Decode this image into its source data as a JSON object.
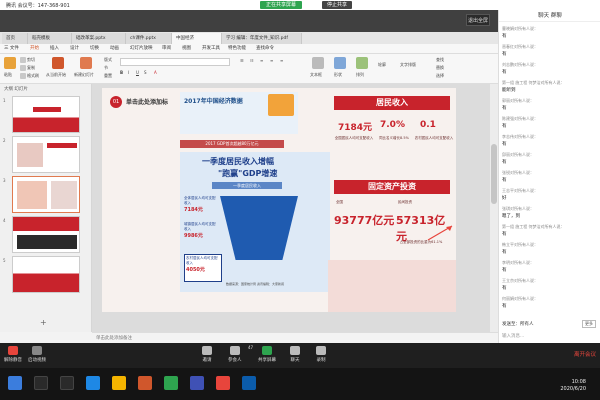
{
  "zoom_top": {
    "meeting_info": "腾讯 会议号：147-368-901",
    "share_label": "正在共享屏幕",
    "stop_label": "停止共享"
  },
  "wps": {
    "fullscreen_label": "退出全屏",
    "tabs": [
      {
        "label": "首页",
        "active": false
      },
      {
        "label": "稻壳模板",
        "active": false
      },
      {
        "label": "础改革案.pptx",
        "active": false
      },
      {
        "label": "ch课件.pptx",
        "active": false
      },
      {
        "label": "中国经济",
        "active": true
      },
      {
        "label": "学习 编辑：年度文件_知识.pdf",
        "active": false
      }
    ],
    "menu": [
      {
        "label": "三 文件",
        "active": false
      },
      {
        "label": "开始",
        "active": true
      },
      {
        "label": "插入",
        "active": false
      },
      {
        "label": "设计",
        "active": false
      },
      {
        "label": "切换",
        "active": false
      },
      {
        "label": "动画",
        "active": false
      },
      {
        "label": "幻灯片放映",
        "active": false
      },
      {
        "label": "审阅",
        "active": false
      },
      {
        "label": "视图",
        "active": false
      },
      {
        "label": "开发工具",
        "active": false
      },
      {
        "label": "特色功能",
        "active": false
      },
      {
        "label": "查找命令",
        "active": false
      }
    ],
    "ribbon": {
      "paste": "粘贴",
      "cut": "剪切",
      "copy": "复制",
      "format_painter": "格式刷",
      "from_current": "从当前开始",
      "new_slide": "新建幻灯片",
      "layout": "版式",
      "section": "节",
      "reset": "重置",
      "text_box": "文本框",
      "shape": "形状",
      "arrange": "排列",
      "outline": "轮廓",
      "text_tools": "文字排版",
      "find": "查找",
      "replace": "替换",
      "select": "选择"
    },
    "panel_head": "大纲  幻灯片",
    "slide_numbers": [
      "1",
      "2",
      "3",
      "4",
      "5"
    ],
    "notes_placeholder": "单击此处添加备注",
    "status": {
      "slide_count": "幻灯片 5 / 40",
      "theme": "Office 主题",
      "zoom": "68%"
    }
  },
  "slide": {
    "badge": "01",
    "click_to_add": "单击此处添加标",
    "left_header": "2017年中国经济数据",
    "left_sub": "2017 GDP首次超越80万亿元",
    "growth_title": "一季度居民收入增幅",
    "growth_title2": "\"跑赢\"GDP增速",
    "growth_sub": "一季度居民收入",
    "left_box1": "全体居民人均可支配收入",
    "left_val1": "7184元",
    "left_box2": "城镇居民人均可支配收入",
    "left_val2": "9986元",
    "left_box3": "农村居民人均可支配收入",
    "left_val3": "4050元",
    "footer_src": "数据来源：国家统计局 资讯编辑：大家新闻",
    "income_title": "居民收入",
    "income_vals": [
      "7184元",
      "7.0%",
      "0.1"
    ],
    "income_labels": [
      "全国居民人均可支配收入",
      "同比名义增长8.5%",
      "农村居民人均可支配收入"
    ],
    "invest_title": "固定资产投资",
    "invest_val1": "93777亿元",
    "invest_val2": "57313亿元",
    "invest_label1": "全国",
    "invest_label2": "民间投资",
    "invest_note": "占全部投资的比重为61.1%"
  },
  "chat": {
    "title": "聊天 群聊",
    "messages": [
      {
        "from": "曹晓娟对所有人说：",
        "text": "有"
      },
      {
        "from": "晋春红对所有人说：",
        "text": "有"
      },
      {
        "from": "刘志鹏对所有人说：",
        "text": "有"
      },
      {
        "from": "第一组 施工程 何梦洁对所有人说：",
        "text": "能听到"
      },
      {
        "from": "郭丽对所有人说：",
        "text": "有"
      },
      {
        "from": "陈建强对所有人说：",
        "text": "有"
      },
      {
        "from": "李志伟对所有人说：",
        "text": "有"
      },
      {
        "from": "邱丽对所有人说：",
        "text": "有"
      },
      {
        "from": "张锐对所有人说：",
        "text": "有"
      },
      {
        "from": "王志平对所有人说：",
        "text": "好"
      },
      {
        "from": "张琪对所有人说：",
        "text": "嗯了，到"
      },
      {
        "from": "第一组 施工程 何梦洁对所有人说：",
        "text": "有"
      },
      {
        "from": "韩立平对所有人说：",
        "text": "有"
      },
      {
        "from": "李明对所有人说：",
        "text": "有"
      },
      {
        "from": "王立京对所有人说：",
        "text": "有"
      },
      {
        "from": "何丽娟对所有人说：",
        "text": "有"
      }
    ],
    "send_to": "发送至：所有人",
    "more": "更多",
    "input_placeholder": "输入消息..."
  },
  "zoom_bottom": {
    "buttons": [
      {
        "label": "解除静音",
        "color": "#e8453c"
      },
      {
        "label": "启动视频",
        "color": "#888888"
      },
      {
        "label": "邀请",
        "color": "#bbbbbb"
      },
      {
        "label": "参会人",
        "color": "#bbbbbb"
      },
      {
        "label": "共享屏幕",
        "color": "#2ea44f"
      },
      {
        "label": "聊天",
        "color": "#bbbbbb"
      },
      {
        "label": "录制",
        "color": "#bbbbbb"
      }
    ],
    "participants_count": "47",
    "end_meeting": "离开会议"
  },
  "taskbar": {
    "time": "10:08",
    "date": "2020/6/20"
  },
  "colors": {
    "accent_red": "#c8232c",
    "wps_orange": "#d0572c",
    "zoom_green": "#2ea44f"
  }
}
